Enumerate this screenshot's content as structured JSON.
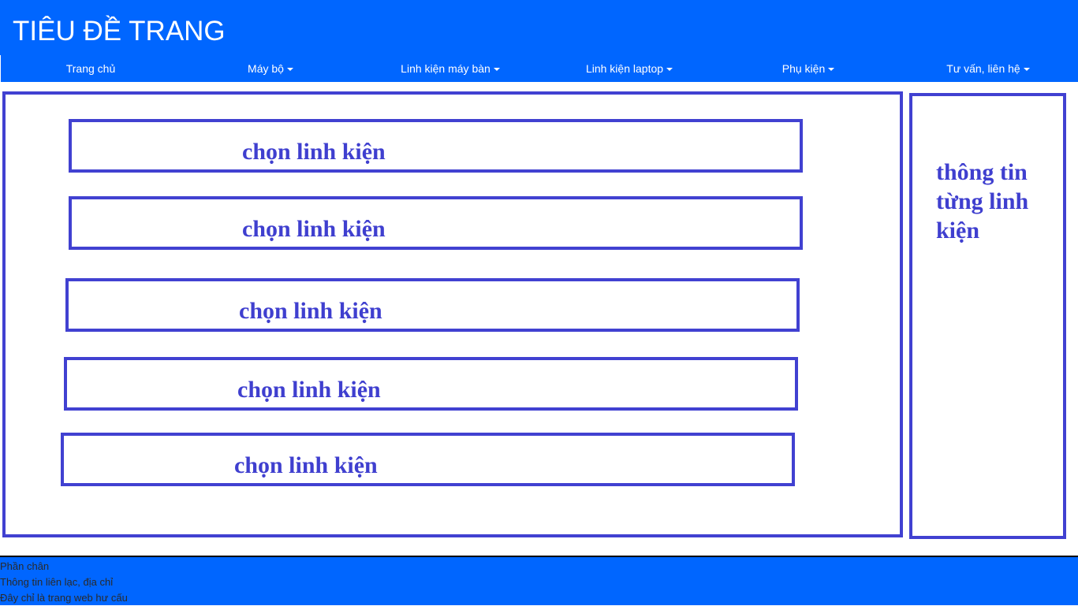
{
  "header": {
    "title": "TIÊU ĐỀ TRANG"
  },
  "nav": {
    "items": [
      {
        "label": "Trang chủ",
        "dropdown": false
      },
      {
        "label": "Máy bộ",
        "dropdown": true
      },
      {
        "label": "Linh kiện máy bàn",
        "dropdown": true
      },
      {
        "label": "Linh kiện laptop",
        "dropdown": true
      },
      {
        "label": "Phụ kiện",
        "dropdown": true
      },
      {
        "label": "Tư vấn, liên hệ",
        "dropdown": true
      }
    ]
  },
  "main": {
    "part_boxes": [
      {
        "label": "chọn linh kiện"
      },
      {
        "label": "chọn linh kiện"
      },
      {
        "label": "chọn linh kiện"
      },
      {
        "label": "chọn linh kiện"
      },
      {
        "label": "chọn linh kiện"
      }
    ]
  },
  "sidebar": {
    "text": "thông tin từng linh kiện"
  },
  "footer": {
    "lines": [
      "Phần chân",
      "Thông tin liên lạc, địa chỉ",
      "Đây chỉ là trang web hư cấu"
    ]
  },
  "colors": {
    "header_bg": "#0066ff",
    "border": "#4141d1",
    "accent_text": "#3f3fcf"
  }
}
